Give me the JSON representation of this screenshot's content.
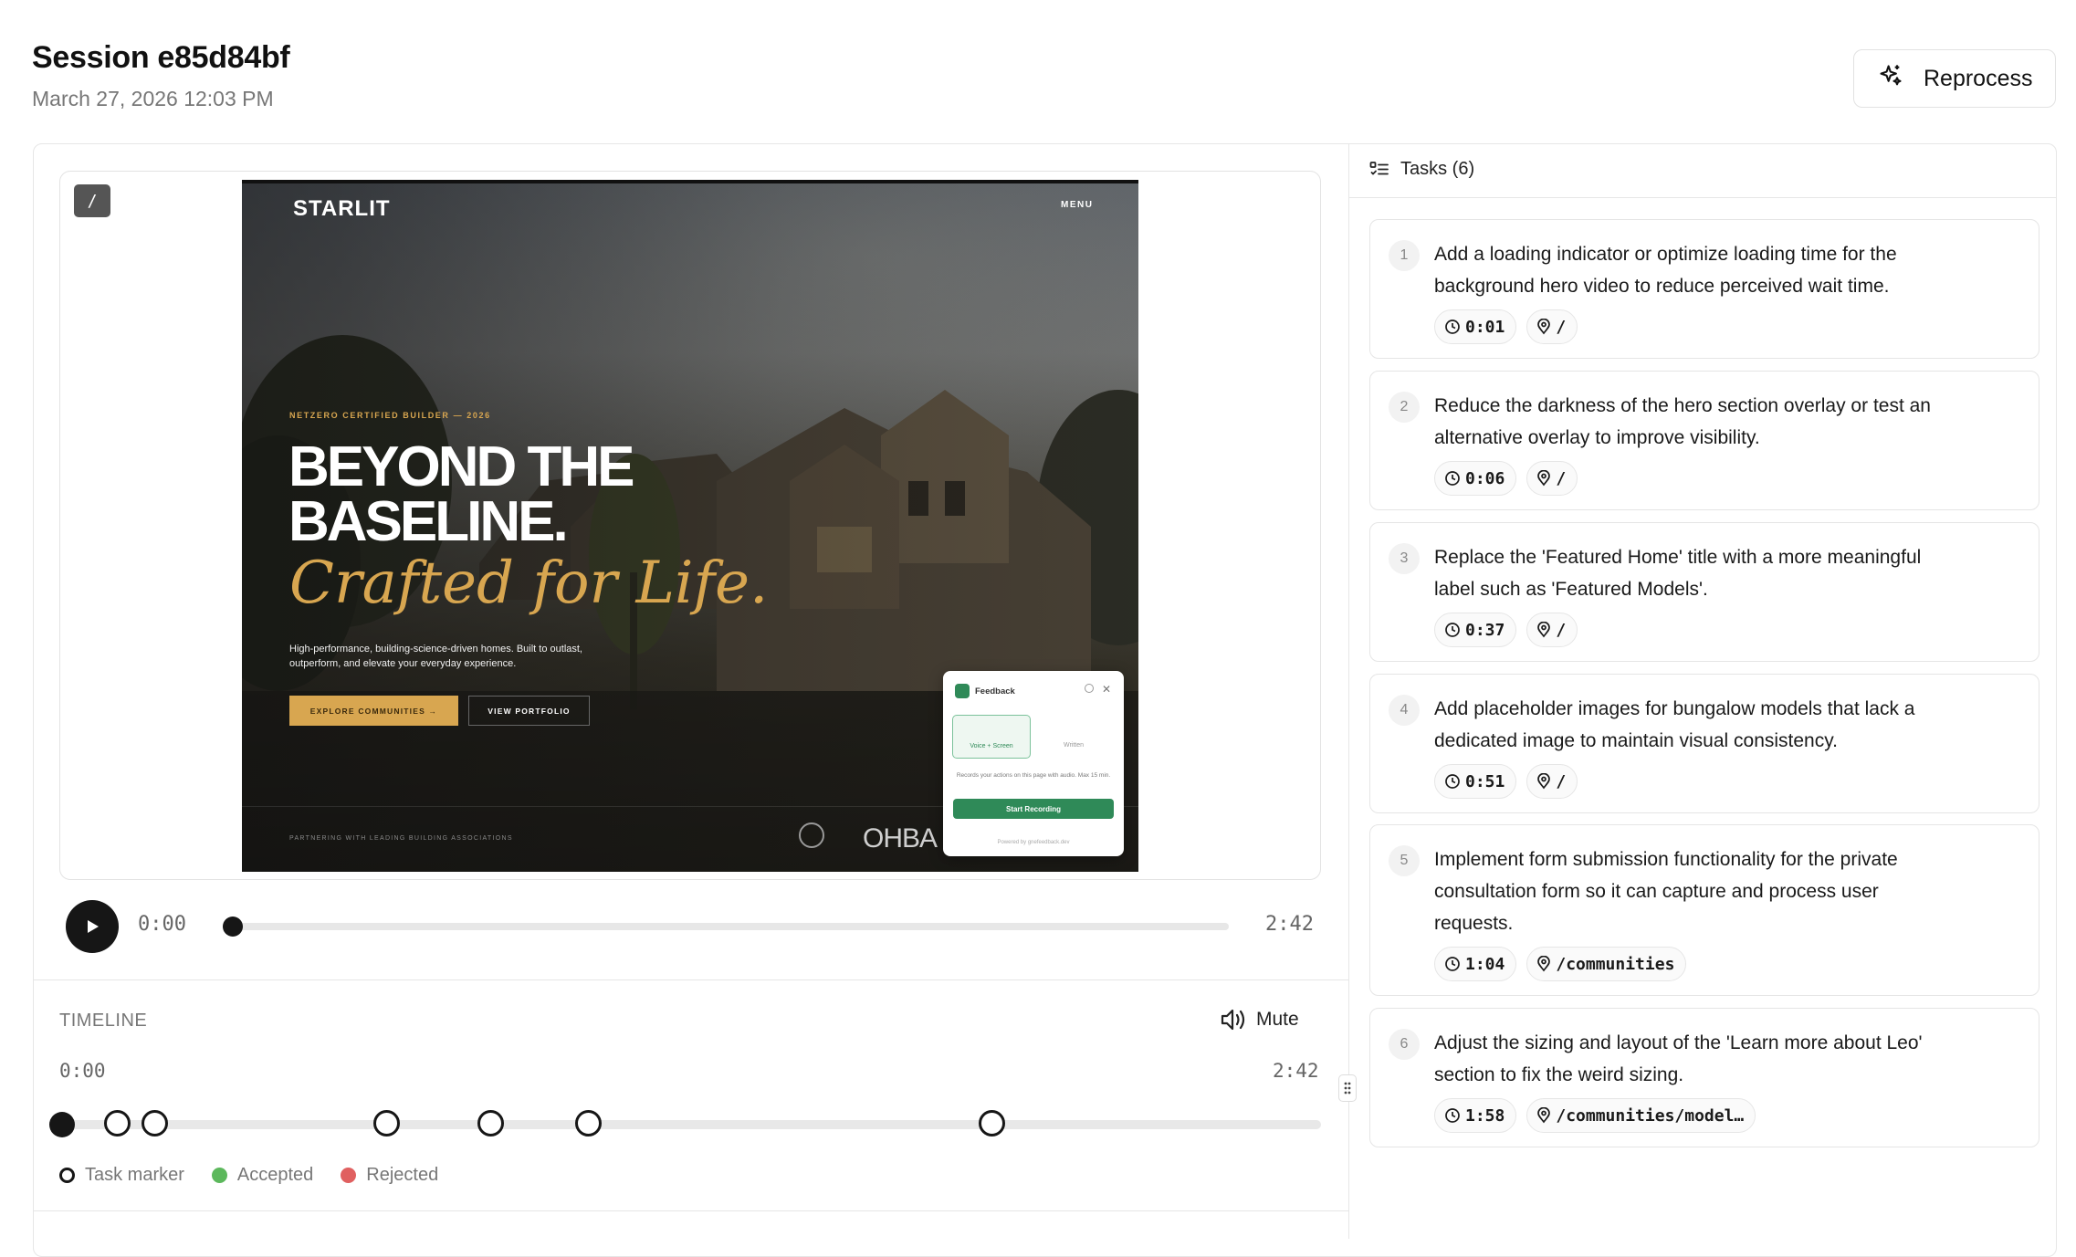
{
  "session": {
    "title": "Session e85d84bf",
    "date": "March 27, 2026 12:03 PM",
    "reprocess_label": "Reprocess"
  },
  "player": {
    "route_badge": "/",
    "current_time": "0:00",
    "duration": "2:42",
    "progress": 0,
    "video_frame": {
      "logo": "STARLIT",
      "menu": "MENU",
      "eyebrow": "NETZERO CERTIFIED BUILDER — 2026",
      "headline_line1": "BEYOND THE",
      "headline_line2": "BASELINE.",
      "headline_italic": "Crafted for Life.",
      "subtext": "High-performance, building-science-driven homes. Built to outlast, outperform, and elevate your everyday experience.",
      "cta_primary": "EXPLORE COMMUNITIES →",
      "cta_secondary": "VIEW PORTFOLIO",
      "partners": "PARTNERING WITH LEADING BUILDING ASSOCIATIONS",
      "partner_logo": "OHBA",
      "feedback_widget": {
        "title": "Feedback",
        "option_voice": "Voice + Screen",
        "option_written": "Written",
        "description": "Records your actions on this page with audio. Max 15 min.",
        "start_button": "Start Recording",
        "powered_by": "Powered by gnefeedback.dev",
        "accent_color": "#2f8a58"
      }
    }
  },
  "timeline": {
    "label": "TIMELINE",
    "mute_label": "Mute",
    "start_time": "0:00",
    "end_time": "2:42",
    "markers_seconds": [
      1,
      6,
      37,
      51,
      64,
      118
    ],
    "legend": [
      {
        "label": "Task marker",
        "color": "#ffffff",
        "border": "#161616"
      },
      {
        "label": "Accepted",
        "color": "#5cb85c",
        "border": "#5cb85c"
      },
      {
        "label": "Rejected",
        "color": "#e06060",
        "border": "#e06060"
      }
    ]
  },
  "tasks_panel": {
    "header": "Tasks (6)",
    "tasks": [
      {
        "number": "1",
        "text": "Add a loading indicator or optimize loading time for the background hero video to reduce perceived wait time.",
        "time": "0:01",
        "path": "/"
      },
      {
        "number": "2",
        "text": "Reduce the darkness of the hero section overlay or test an alternative overlay to improve visibility.",
        "time": "0:06",
        "path": "/"
      },
      {
        "number": "3",
        "text": "Replace the 'Featured Home' title with a more meaningful label such as 'Featured Models'.",
        "time": "0:37",
        "path": "/"
      },
      {
        "number": "4",
        "text": "Add placeholder images for bungalow models that lack a dedicated image to maintain visual consistency.",
        "time": "0:51",
        "path": "/"
      },
      {
        "number": "5",
        "text": "Implement form submission functionality for the private consultation form so it can capture and process user requests.",
        "time": "1:04",
        "path": "/communities"
      },
      {
        "number": "6",
        "text": "Adjust the sizing and layout of the 'Learn more about Leo' section to fix the weird sizing.",
        "time": "1:58",
        "path": "/communities/model…"
      }
    ]
  }
}
